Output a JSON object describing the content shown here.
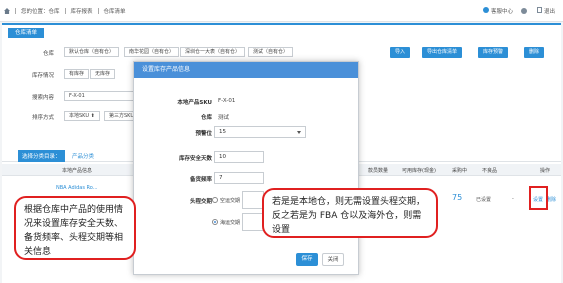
{
  "topbar": {
    "breadcrumb": [
      "您的位置：仓库",
      "库存报表",
      "仓库清单"
    ],
    "customer_service": "客服中心",
    "logout": "退出"
  },
  "panel": {
    "tab": "仓库清单",
    "warehouse_label": "仓库",
    "warehouse_options": [
      "默认仓库（自有仓）",
      "南华花园（自有仓）",
      "深圳仓一大表（自有仓）",
      "测试（自有仓）"
    ],
    "actions": [
      "导入",
      "导出仓库清单",
      "库存预警",
      "删除"
    ],
    "stock_label": "库存情况",
    "stock_options": [
      "有库存",
      "无库存"
    ],
    "search_label": "搜索内容",
    "search_value": "F-X-01",
    "sort_label": "排序方式",
    "sort_options": [
      "本地SKU ⬆",
      "第三方SKU"
    ]
  },
  "filter": {
    "group_label": "选择分类目录：",
    "category": "产品分类"
  },
  "table": {
    "headers": [
      "本地产品信息",
      "款员数量",
      "可用库存(现金)",
      "采购中",
      "不良品",
      "操作"
    ],
    "row": {
      "link": "NBA Adidas Ro...",
      "purchasing": "75",
      "status": "已设置",
      "defect": "-",
      "op1": "设置",
      "op2": "删除"
    }
  },
  "modal": {
    "title": "设置库存产品信息",
    "sku_label": "本地产品SKU",
    "sku_value": "F-X-01",
    "warehouse_label": "仓库",
    "warehouse_value": "测试",
    "alert_label": "预警位",
    "alert_value": "15",
    "safety_label": "库存安全天数",
    "safety_value": "10",
    "freq_label": "备货频率",
    "freq_value": "7",
    "lead_label": "头程交期",
    "radio1": "空运交期",
    "radio2": "海运交期",
    "save": "保存",
    "close": "关闭"
  },
  "callouts": {
    "left": "根据仓库中产品的使用情况来设置库存安全天数、备货频率、头程交期等相关信息",
    "right": "若是是本地仓，则无需设置头程交期，反之若是为 FBA 仓以及海外仓，则需设置"
  }
}
